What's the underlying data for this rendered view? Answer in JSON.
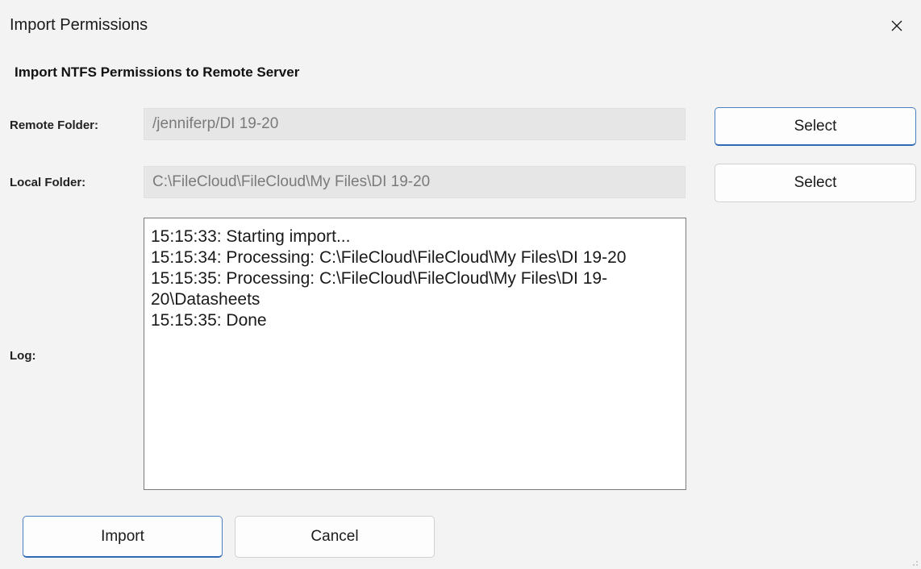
{
  "window": {
    "title": "Import Permissions"
  },
  "dialog": {
    "heading": "Import NTFS Permissions to Remote Server",
    "remote_folder": {
      "label": "Remote Folder:",
      "value": "/jenniferp/DI 19-20",
      "button_label": "Select"
    },
    "local_folder": {
      "label": "Local Folder:",
      "value": "C:\\FileCloud\\FileCloud\\My Files\\DI 19-20",
      "button_label": "Select"
    },
    "log": {
      "label": "Log:",
      "lines": [
        "15:15:33: Starting import...",
        "15:15:34: Processing: C:\\FileCloud\\FileCloud\\My Files\\DI 19-20",
        "15:15:35: Processing: C:\\FileCloud\\FileCloud\\My Files\\DI 19-20\\Datasheets",
        "15:15:35: Done"
      ]
    },
    "actions": {
      "import_label": "Import",
      "cancel_label": "Cancel"
    }
  },
  "icons": {
    "close": "close-icon",
    "resize": "resize-grip-icon"
  },
  "colors": {
    "background": "#f3f3f3",
    "accent_border": "#2f6ab5",
    "field_background": "#e6e6e6"
  }
}
